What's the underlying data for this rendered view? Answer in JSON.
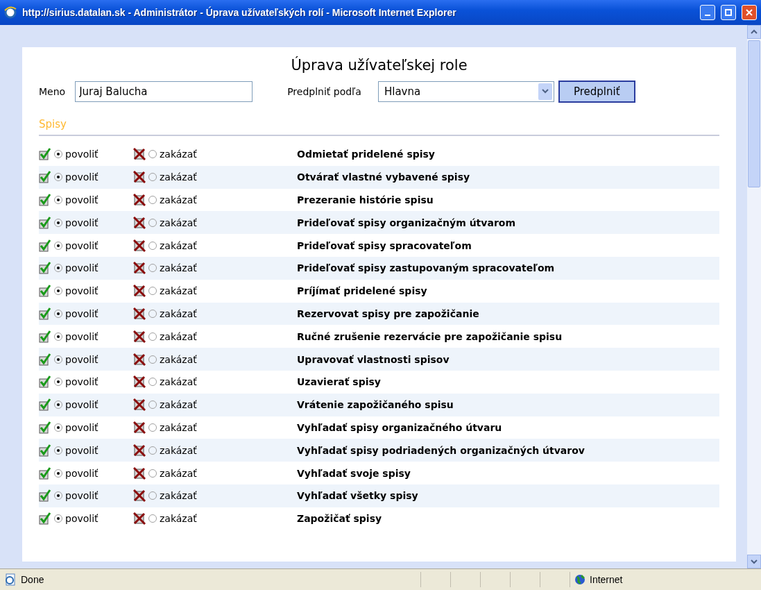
{
  "window": {
    "title": "http://sirius.datalan.sk - Administrátor - Úprava užívateľských rolí - Microsoft Internet Explorer"
  },
  "heading": "Úprava užívateľskej role",
  "name_field": {
    "label": "Meno",
    "value": "Juraj Balucha"
  },
  "prefill": {
    "label": "Predplniť podľa",
    "value": "Hlavna",
    "button": "Predplniť"
  },
  "section": "Spisy",
  "rows": [
    {
      "allow_label": "povoliť",
      "deny_label": "zakázať",
      "allowed": true,
      "name": "Odmietať pridelené spisy"
    },
    {
      "allow_label": "povoliť",
      "deny_label": "zakázať",
      "allowed": true,
      "name": "Otvárať vlastné vybavené spisy"
    },
    {
      "allow_label": "povoliť",
      "deny_label": "zakázať",
      "allowed": true,
      "name": "Prezeranie histórie spisu"
    },
    {
      "allow_label": "povoliť",
      "deny_label": "zakázať",
      "allowed": true,
      "name": "Prideľovať spisy organizačným útvarom"
    },
    {
      "allow_label": "povoliť",
      "deny_label": "zakázať",
      "allowed": true,
      "name": "Prideľovať spisy spracovateľom"
    },
    {
      "allow_label": "povoliť",
      "deny_label": "zakázať",
      "allowed": true,
      "name": "Prideľovať spisy zastupovaným spracovateľom"
    },
    {
      "allow_label": "povoliť",
      "deny_label": "zakázať",
      "allowed": true,
      "name": "Príjímať pridelené spisy"
    },
    {
      "allow_label": "povoliť",
      "deny_label": "zakázať",
      "allowed": true,
      "name": "Rezervovat spisy pre zapožičanie"
    },
    {
      "allow_label": "povoliť",
      "deny_label": "zakázať",
      "allowed": true,
      "name": "Ručné zrušenie rezervácie pre zapožičanie spisu"
    },
    {
      "allow_label": "povoliť",
      "deny_label": "zakázať",
      "allowed": true,
      "name": "Upravovať vlastnosti spisov"
    },
    {
      "allow_label": "povoliť",
      "deny_label": "zakázať",
      "allowed": true,
      "name": "Uzavierať spisy"
    },
    {
      "allow_label": "povoliť",
      "deny_label": "zakázať",
      "allowed": true,
      "name": "Vrátenie zapožičaného spisu"
    },
    {
      "allow_label": "povoliť",
      "deny_label": "zakázať",
      "allowed": true,
      "name": "Vyhľadať spisy organizačného útvaru"
    },
    {
      "allow_label": "povoliť",
      "deny_label": "zakázať",
      "allowed": true,
      "name": "Vyhľadať spisy podriadených organizačných útvarov"
    },
    {
      "allow_label": "povoliť",
      "deny_label": "zakázať",
      "allowed": true,
      "name": "Vyhľadať svoje spisy"
    },
    {
      "allow_label": "povoliť",
      "deny_label": "zakázať",
      "allowed": true,
      "name": "Vyhľadať všetky spisy"
    },
    {
      "allow_label": "povoliť",
      "deny_label": "zakázať",
      "allowed": true,
      "name": "Zapožičať spisy"
    }
  ],
  "status_bar": {
    "text": "Done",
    "zone": "Internet"
  }
}
